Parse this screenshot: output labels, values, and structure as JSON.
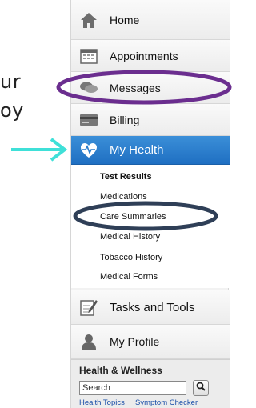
{
  "background": {
    "line1": "ur",
    "line2": "oy"
  },
  "nav": {
    "home": "Home",
    "appointments": "Appointments",
    "messages": "Messages",
    "billing": "Billing",
    "my_health": "My Health",
    "tasks": "Tasks and Tools",
    "profile": "My Profile"
  },
  "health_subnav": [
    {
      "label": "Test Results"
    },
    {
      "label": "Medications"
    },
    {
      "label": "Care Summaries"
    },
    {
      "label": "Medical History"
    },
    {
      "label": "Tobacco History"
    },
    {
      "label": "Medical Forms"
    }
  ],
  "health_wellness": {
    "title": "Health & Wellness",
    "search_value": "Search",
    "link_topics": "Health Topics",
    "link_checker": "Symptom Checker"
  },
  "colors": {
    "active_blue": "#2a7ccc",
    "highlight_purple": "#6b2e8f",
    "highlight_navy": "#2f3f57",
    "arrow_cyan": "#3fe0d8"
  }
}
